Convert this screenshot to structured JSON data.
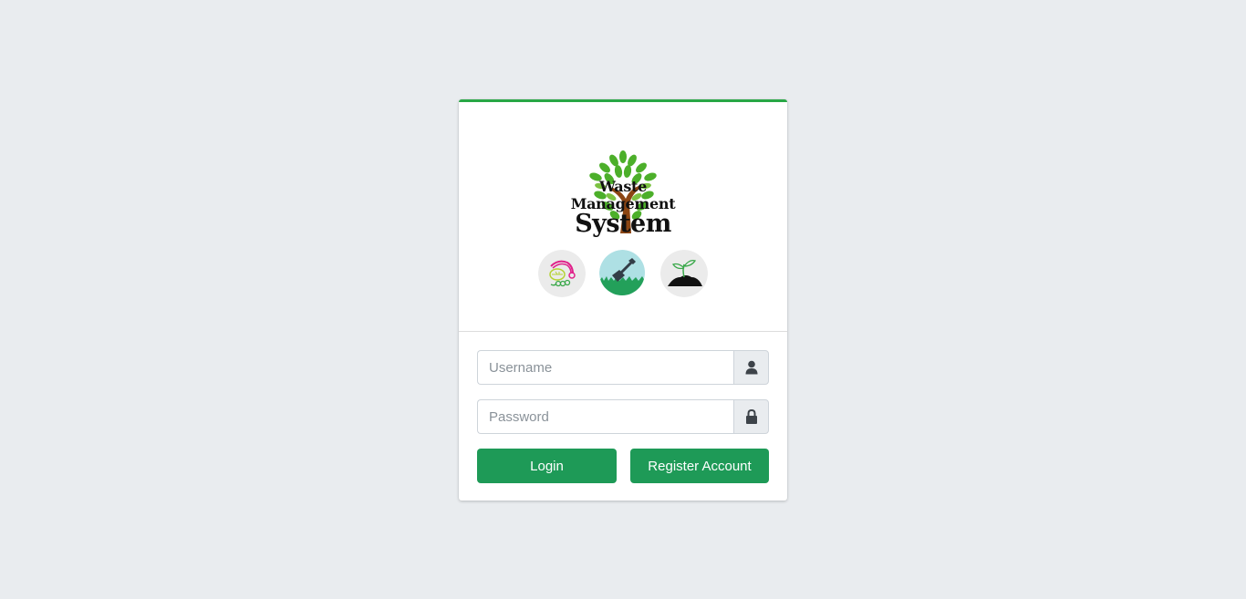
{
  "logo": {
    "line1": "Waste Management",
    "line2": "System",
    "icons": [
      "vegetable-scraps-icon",
      "shovel-grass-icon",
      "sprout-soil-icon"
    ]
  },
  "form": {
    "username": {
      "placeholder": "Username",
      "value": "",
      "icon": "user-icon"
    },
    "password": {
      "placeholder": "Password",
      "value": "",
      "icon": "lock-icon"
    },
    "login_label": "Login",
    "register_label": "Register Account"
  },
  "colors": {
    "accent": "#28a745",
    "button": "#1e9a57",
    "background": "#e9ecef"
  }
}
